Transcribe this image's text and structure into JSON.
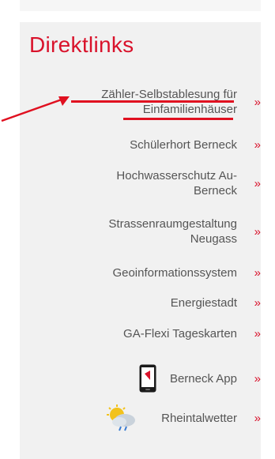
{
  "heading": "Direktlinks",
  "links": [
    {
      "line1": "Zähler-Selbstablesung für",
      "line2": "Einfamilienhäuser"
    },
    {
      "line1": "Schülerhort Berneck"
    },
    {
      "line1": "Hochwasserschutz Au-",
      "line2": "Berneck"
    },
    {
      "line1": "Strassenraumgestaltung",
      "line2": "Neugass"
    },
    {
      "line1": "Geoinformationssystem"
    },
    {
      "line1": "Energiestadt"
    },
    {
      "line1": "GA-Flexi Tageskarten"
    },
    {
      "line1": "Berneck App",
      "icon": "smartphone-icon"
    },
    {
      "line1": "Rheintalwetter",
      "icon": "weather-icon"
    }
  ],
  "arrow_glyph": "»",
  "colors": {
    "accent": "#d9122b",
    "text": "#555555",
    "panel": "#f1f1f1",
    "annotation": "#e01020"
  }
}
